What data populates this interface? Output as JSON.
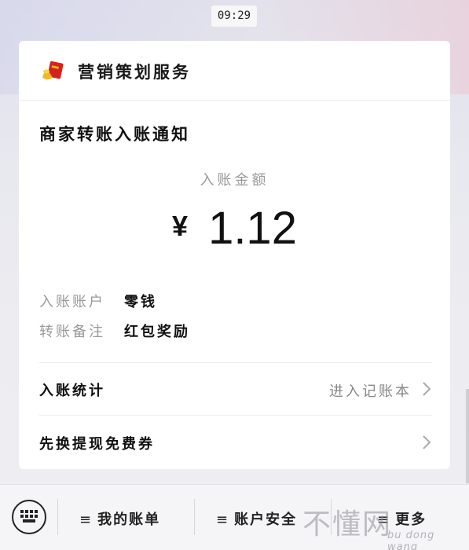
{
  "status": {
    "time": "09:29"
  },
  "service": {
    "name": "营销策划服务",
    "icon": "red-envelope-icon"
  },
  "notice": {
    "title": "商家转账入账通知",
    "amount_label": "入账金额",
    "currency": "¥",
    "amount": "1.12",
    "details": [
      {
        "key": "入账账户",
        "value": "零钱"
      },
      {
        "key": "转账备注",
        "value": "红包奖励"
      }
    ],
    "rows": [
      {
        "label": "入账统计",
        "value": "进入记账本"
      },
      {
        "label": "先换提现免费券",
        "value": ""
      }
    ]
  },
  "bottom_menu": {
    "keyboard_icon": "keyboard-icon",
    "items": [
      "我的账单",
      "账户安全",
      "更多"
    ]
  },
  "watermark": {
    "text": "不懂网",
    "sub": "bu dong wang"
  },
  "colors": {
    "card": "#ffffff",
    "accent_red": "#d4231f",
    "gold": "#f0b520"
  }
}
